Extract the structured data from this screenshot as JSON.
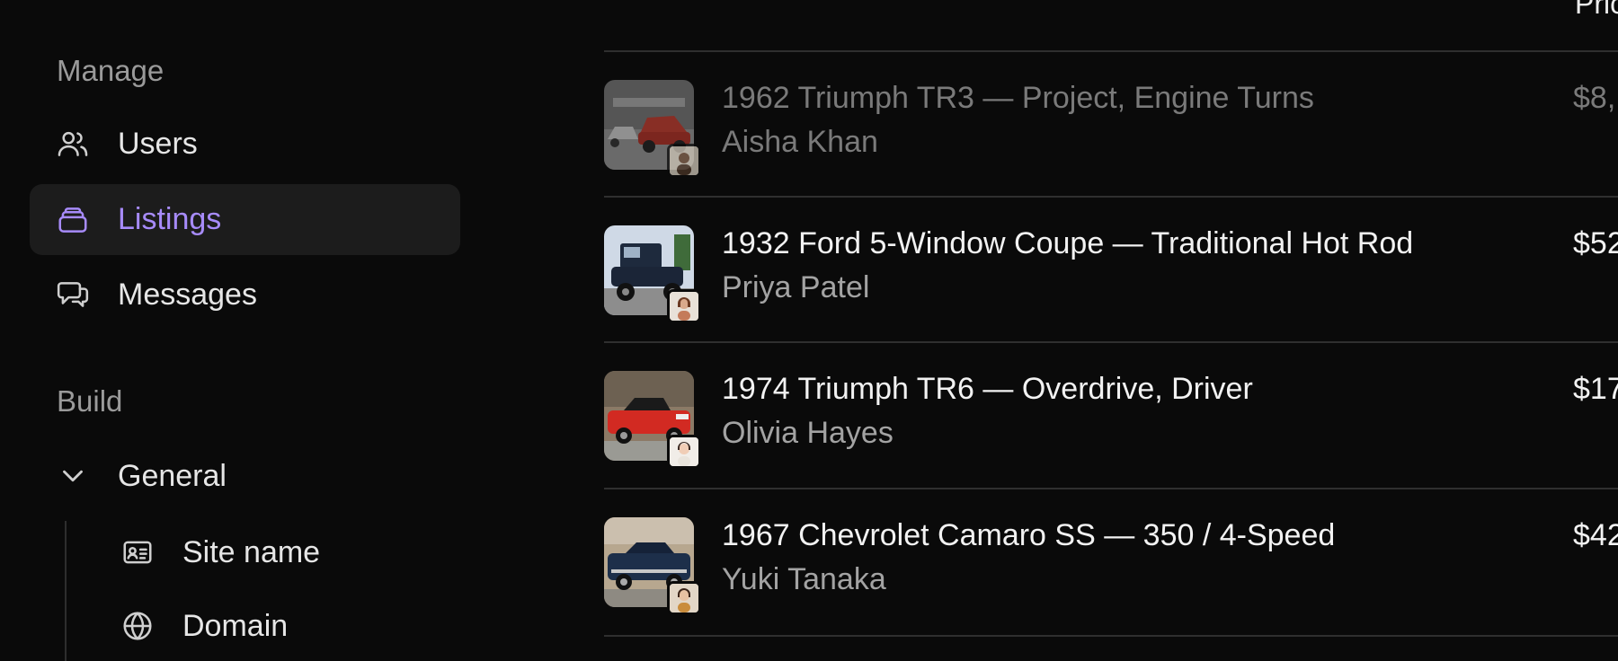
{
  "sidebar": {
    "manage_label": "Manage",
    "items": [
      {
        "label": "Users",
        "icon": "users-icon"
      },
      {
        "label": "Listings",
        "icon": "layers-icon",
        "active": true
      },
      {
        "label": "Messages",
        "icon": "chat-bubbles-icon"
      }
    ],
    "build_label": "Build",
    "general": {
      "label": "General",
      "icon": "chevron-down-icon"
    },
    "sub_items": [
      {
        "label": "Site name",
        "icon": "id-card-icon"
      },
      {
        "label": "Domain",
        "icon": "globe-icon"
      }
    ]
  },
  "table": {
    "price_header": "Pric",
    "rows": [
      {
        "title": "1962 Triumph TR3 — Project, Engine Turns",
        "owner": "Aisha Khan",
        "price": "$8,",
        "dimmed": true,
        "car_color": "#b33a2e"
      },
      {
        "title": "1932 Ford 5-Window Coupe — Traditional Hot Rod",
        "owner": "Priya Patel",
        "price": "$52",
        "car_color": "#1e2a3d"
      },
      {
        "title": "1974 Triumph TR6 — Overdrive, Driver",
        "owner": "Olivia Hayes",
        "price": "$17",
        "car_color": "#d22a22"
      },
      {
        "title": "1967 Chevrolet Camaro SS — 350 / 4-Speed",
        "owner": "Yuki Tanaka",
        "price": "$42",
        "car_color": "#1d2f4a"
      }
    ]
  },
  "colors": {
    "accent": "#a78bfa",
    "background": "#0a0a0a",
    "active_bg": "#1c1c1c"
  }
}
